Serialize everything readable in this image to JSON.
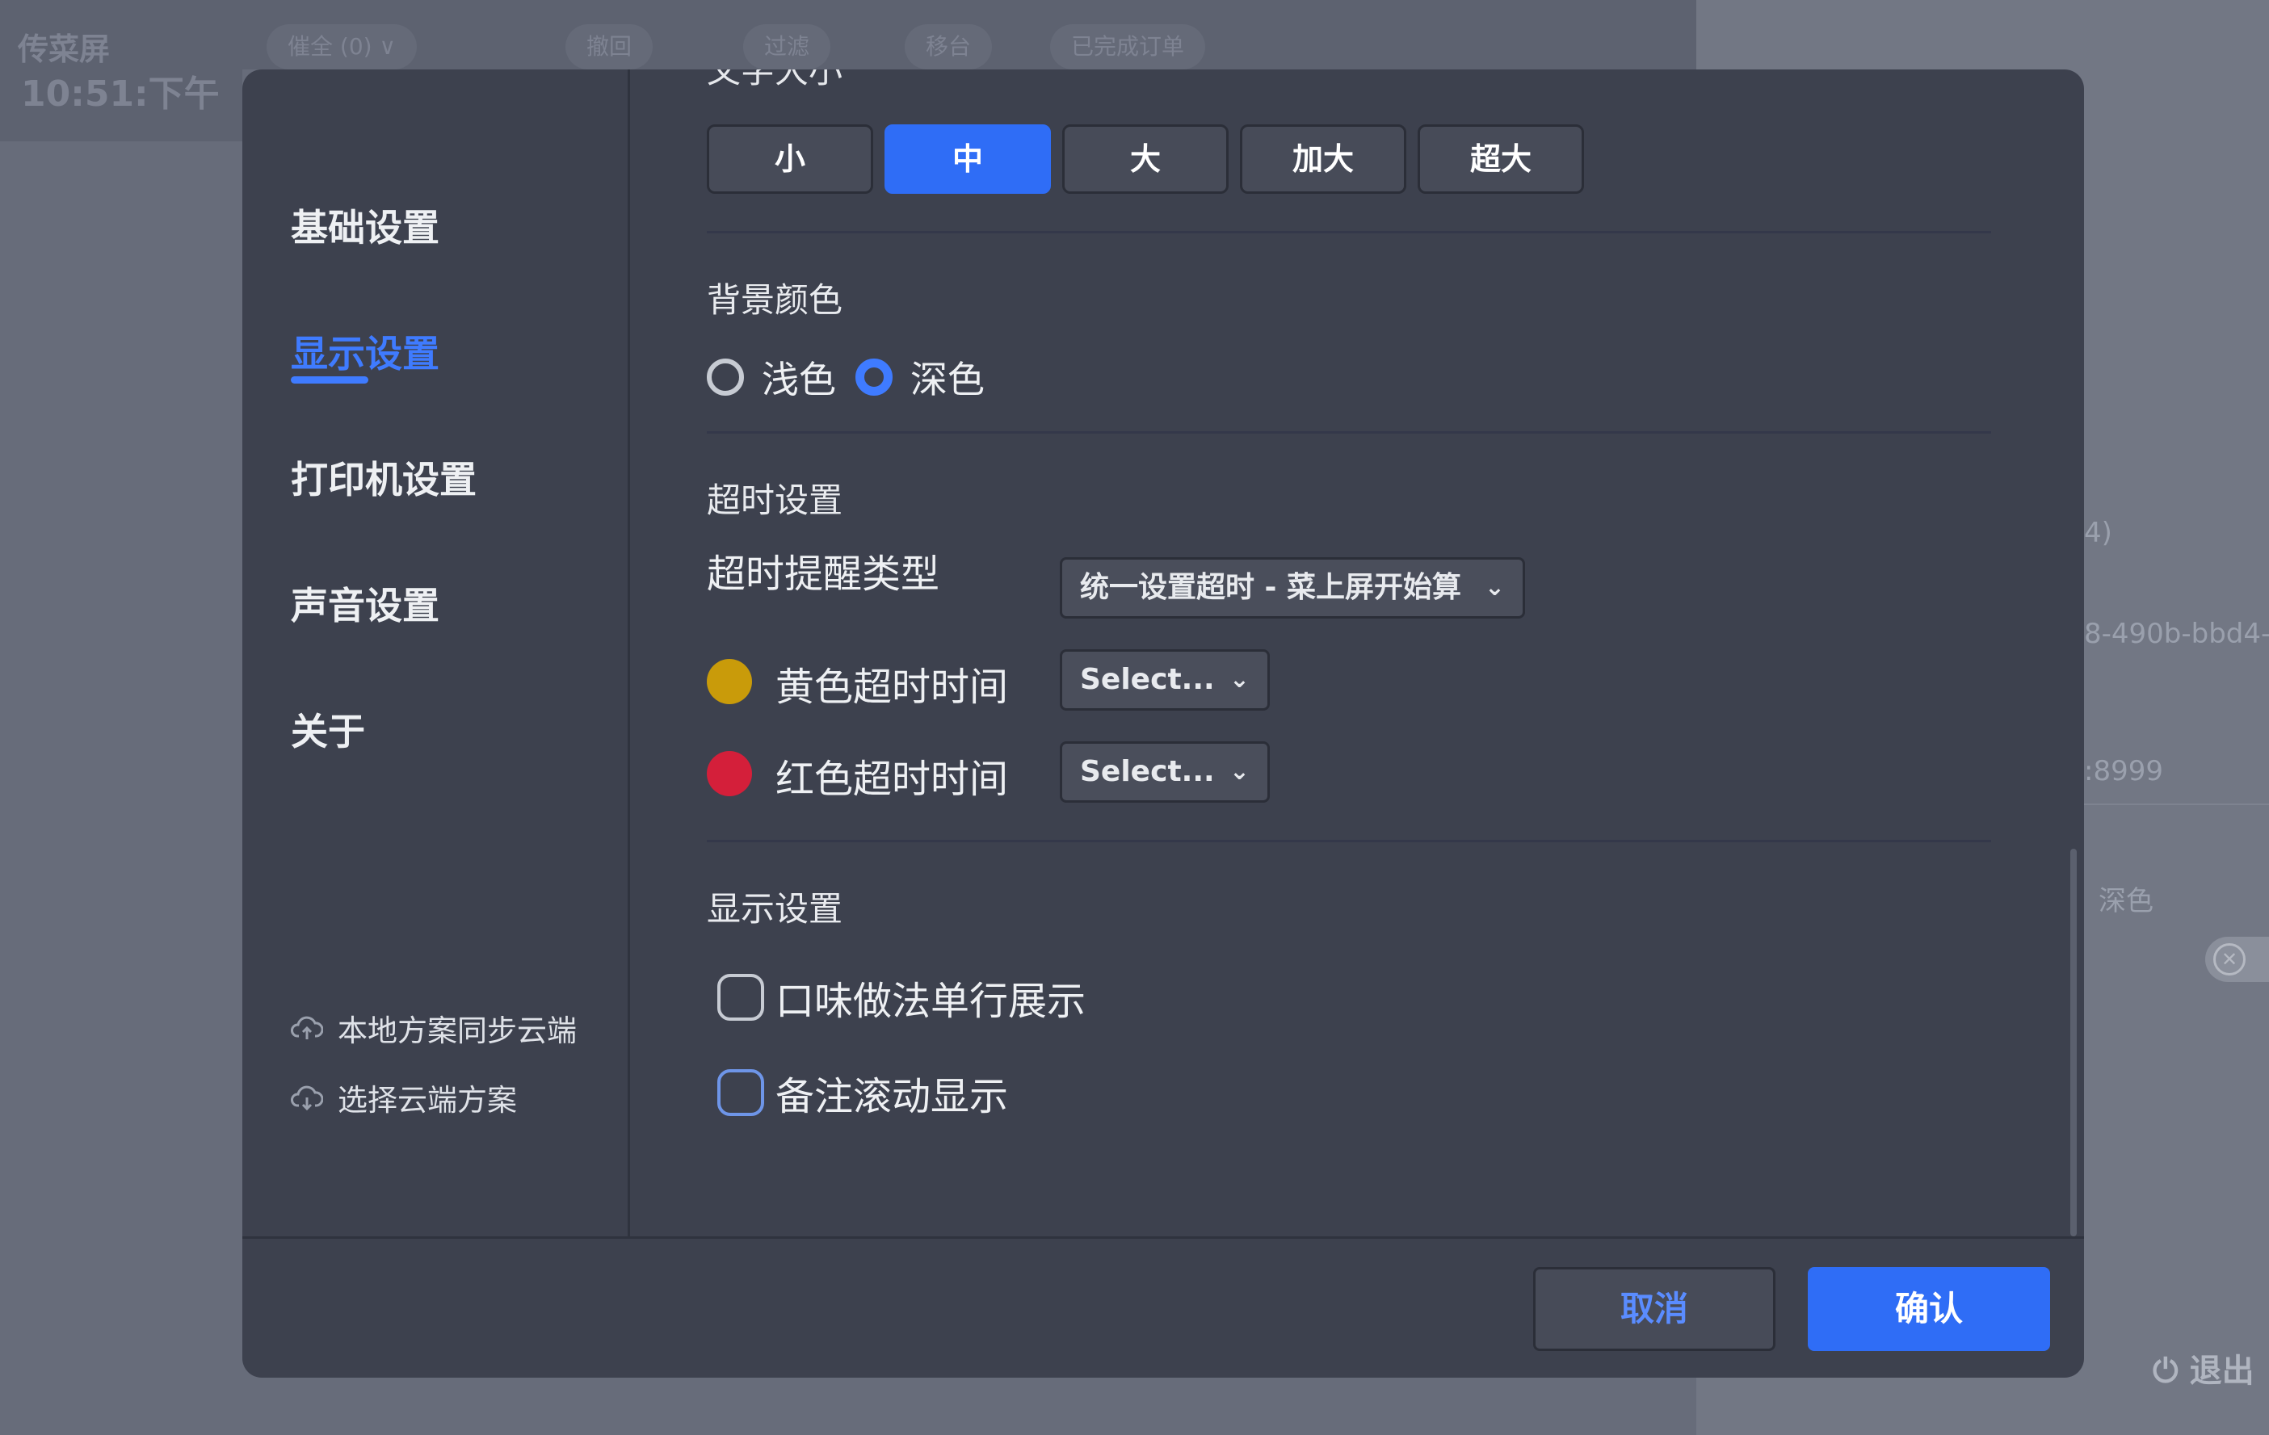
{
  "background": {
    "screen_title": "传菜屏",
    "clock": "10:51:下午",
    "right_texts": [
      "4)",
      "8-490b-bbd4-",
      ":8999",
      "深色"
    ],
    "exit_label": "退出",
    "top_pills": [
      "催全 (0) ∨",
      "撤回",
      "过滤",
      "移台",
      "已完成订单"
    ]
  },
  "sidebar": {
    "items": [
      {
        "label": "基础设置",
        "active": false
      },
      {
        "label": "显示设置",
        "active": true
      },
      {
        "label": "打印机设置",
        "active": false
      },
      {
        "label": "声音设置",
        "active": false
      },
      {
        "label": "关于",
        "active": false
      }
    ],
    "sync_upload": "本地方案同步云端",
    "select_cloud": "选择云端方案"
  },
  "font_size": {
    "title": "文字大小",
    "options": [
      "小",
      "中",
      "大",
      "加大",
      "超大"
    ],
    "selected": "中"
  },
  "background_color": {
    "title": "背景颜色",
    "options": [
      "浅色",
      "深色"
    ],
    "selected": "深色"
  },
  "timeout": {
    "title": "超时设置",
    "type_label": "超时提醒类型",
    "type_value": "统一设置超时 - 菜上屏开始算",
    "yellow_label": "黄色超时时间",
    "yellow_value": "Select...",
    "red_label": "红色超时时间",
    "red_value": "Select...",
    "yellow_color": "#c99b0a",
    "red_color": "#d41f3a"
  },
  "display": {
    "title": "显示设置",
    "options": [
      {
        "label": "口味做法单行展示",
        "checked": false
      },
      {
        "label": "备注滚动显示",
        "checked": false
      }
    ]
  },
  "footer": {
    "cancel": "取消",
    "confirm": "确认"
  },
  "colors": {
    "accent": "#2f6df6",
    "modal_bg": "#3d414e"
  }
}
